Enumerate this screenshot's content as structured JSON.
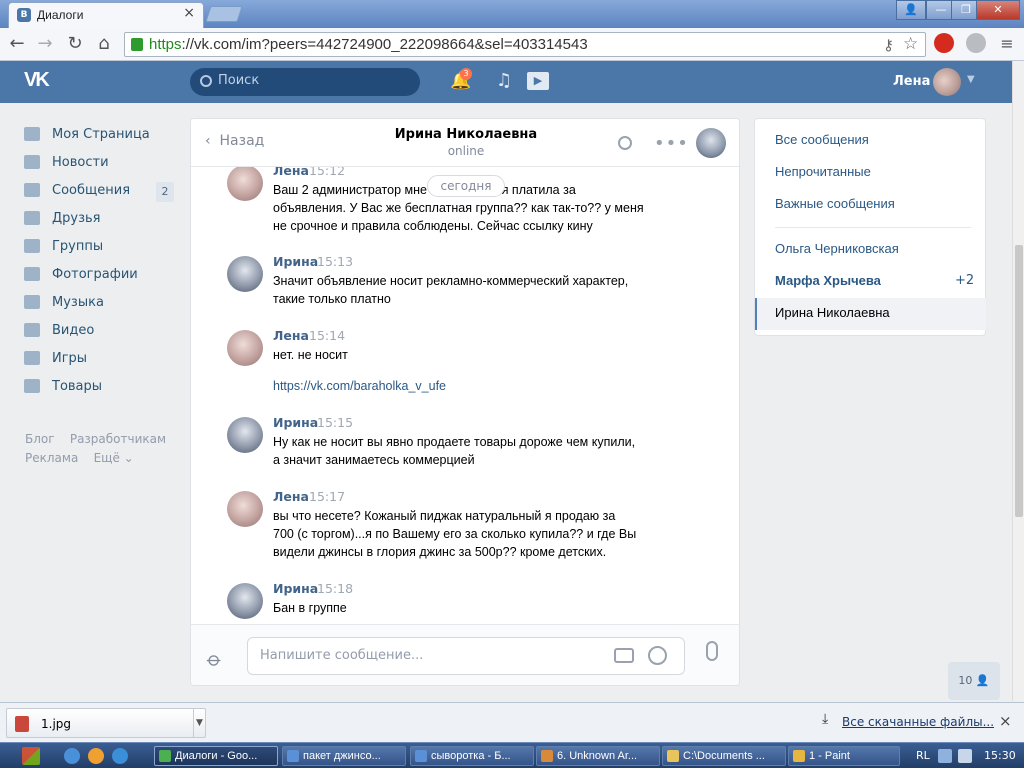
{
  "browser": {
    "tab_title": "Диалоги",
    "tab_close": "×",
    "url_scheme": "https",
    "url_rest": "://vk.com/im?peers=442724900_222098664&sel=403314543",
    "controls": {
      "min": "—",
      "max": "❐",
      "close": "✕",
      "profile": "👤"
    }
  },
  "vk_header": {
    "logo": "VK",
    "search_placeholder": "Поиск",
    "notifications_count": "3",
    "user_name": "Лена"
  },
  "left_menu": [
    {
      "label": "Моя Страница",
      "icon": "home-icon"
    },
    {
      "label": "Новости",
      "icon": "news-icon"
    },
    {
      "label": "Сообщения",
      "icon": "messages-icon",
      "count": "2"
    },
    {
      "label": "Друзья",
      "icon": "friends-icon"
    },
    {
      "label": "Группы",
      "icon": "groups-icon"
    },
    {
      "label": "Фотографии",
      "icon": "photos-icon"
    },
    {
      "label": "Музыка",
      "icon": "music-icon"
    },
    {
      "label": "Видео",
      "icon": "video-icon"
    },
    {
      "label": "Игры",
      "icon": "games-icon"
    },
    {
      "label": "Товары",
      "icon": "goods-icon"
    }
  ],
  "footer_links": {
    "blog": "Блог",
    "dev": "Разработчикам",
    "ads": "Реклама",
    "more": "Ещё"
  },
  "chat": {
    "back_label": "Назад",
    "peer_name": "Ирина Николаевна",
    "peer_status": "online",
    "date_pill": "сегодня",
    "messages": [
      {
        "author": "Лена",
        "time": "15:12",
        "lines": [
          "Ваш 2 администратор мне пишет, чтоб я платила за",
          "объявления. У Вас же бесплатная группа?? как так-то?? у меня",
          "не срочное и правила соблюдены. Сейчас ссылку кину"
        ]
      },
      {
        "author": "Ирина",
        "time": "15:13",
        "lines": [
          "Значит объявление носит рекламно-коммерческий характер,",
          "такие только платно"
        ]
      },
      {
        "author": "Лена",
        "time": "15:14",
        "lines": [
          "нет. не носит"
        ],
        "link": "https://vk.com/baraholka_v_ufe"
      },
      {
        "author": "Ирина",
        "time": "15:15",
        "lines": [
          "Ну как не носит вы явно продаете товары дороже чем купили,",
          "а значит занимаетесь коммерцией"
        ]
      },
      {
        "author": "Лена",
        "time": "15:17",
        "lines": [
          "вы что несете? Кожаный пиджак натуральный я продаю за",
          "700 (с торгом)...я по Вашему его за сколько купила?? и где Вы",
          "видели джинсы в глория джинс за 500р?? кроме детских."
        ]
      },
      {
        "author": "Ирина",
        "time": "15:18",
        "lines": [
          "Бан в группе"
        ]
      }
    ],
    "composer_placeholder": "Напишите сообщение..."
  },
  "right_panel": {
    "all": "Все сообщения",
    "unread": "Непрочитанные",
    "important": "Важные сообщения",
    "convs": [
      {
        "name": "Ольга Черниковская",
        "extra": ""
      },
      {
        "name": "Марфа Хрычева",
        "extra": "+2"
      },
      {
        "name": "Ирина Николаевна",
        "extra": ""
      }
    ]
  },
  "online_count": "10",
  "downloads": {
    "file": "1.jpg",
    "all_link": "Все скачанные файлы...",
    "close": "×"
  },
  "taskbar": {
    "items": [
      "Диалоги - Goo...",
      "пакет джинсо...",
      "сыворотка - Б...",
      "6. Unknown Ar...",
      "C:\\Documents ...",
      "1 - Paint"
    ],
    "lang": "RL",
    "clock": "15:30"
  }
}
